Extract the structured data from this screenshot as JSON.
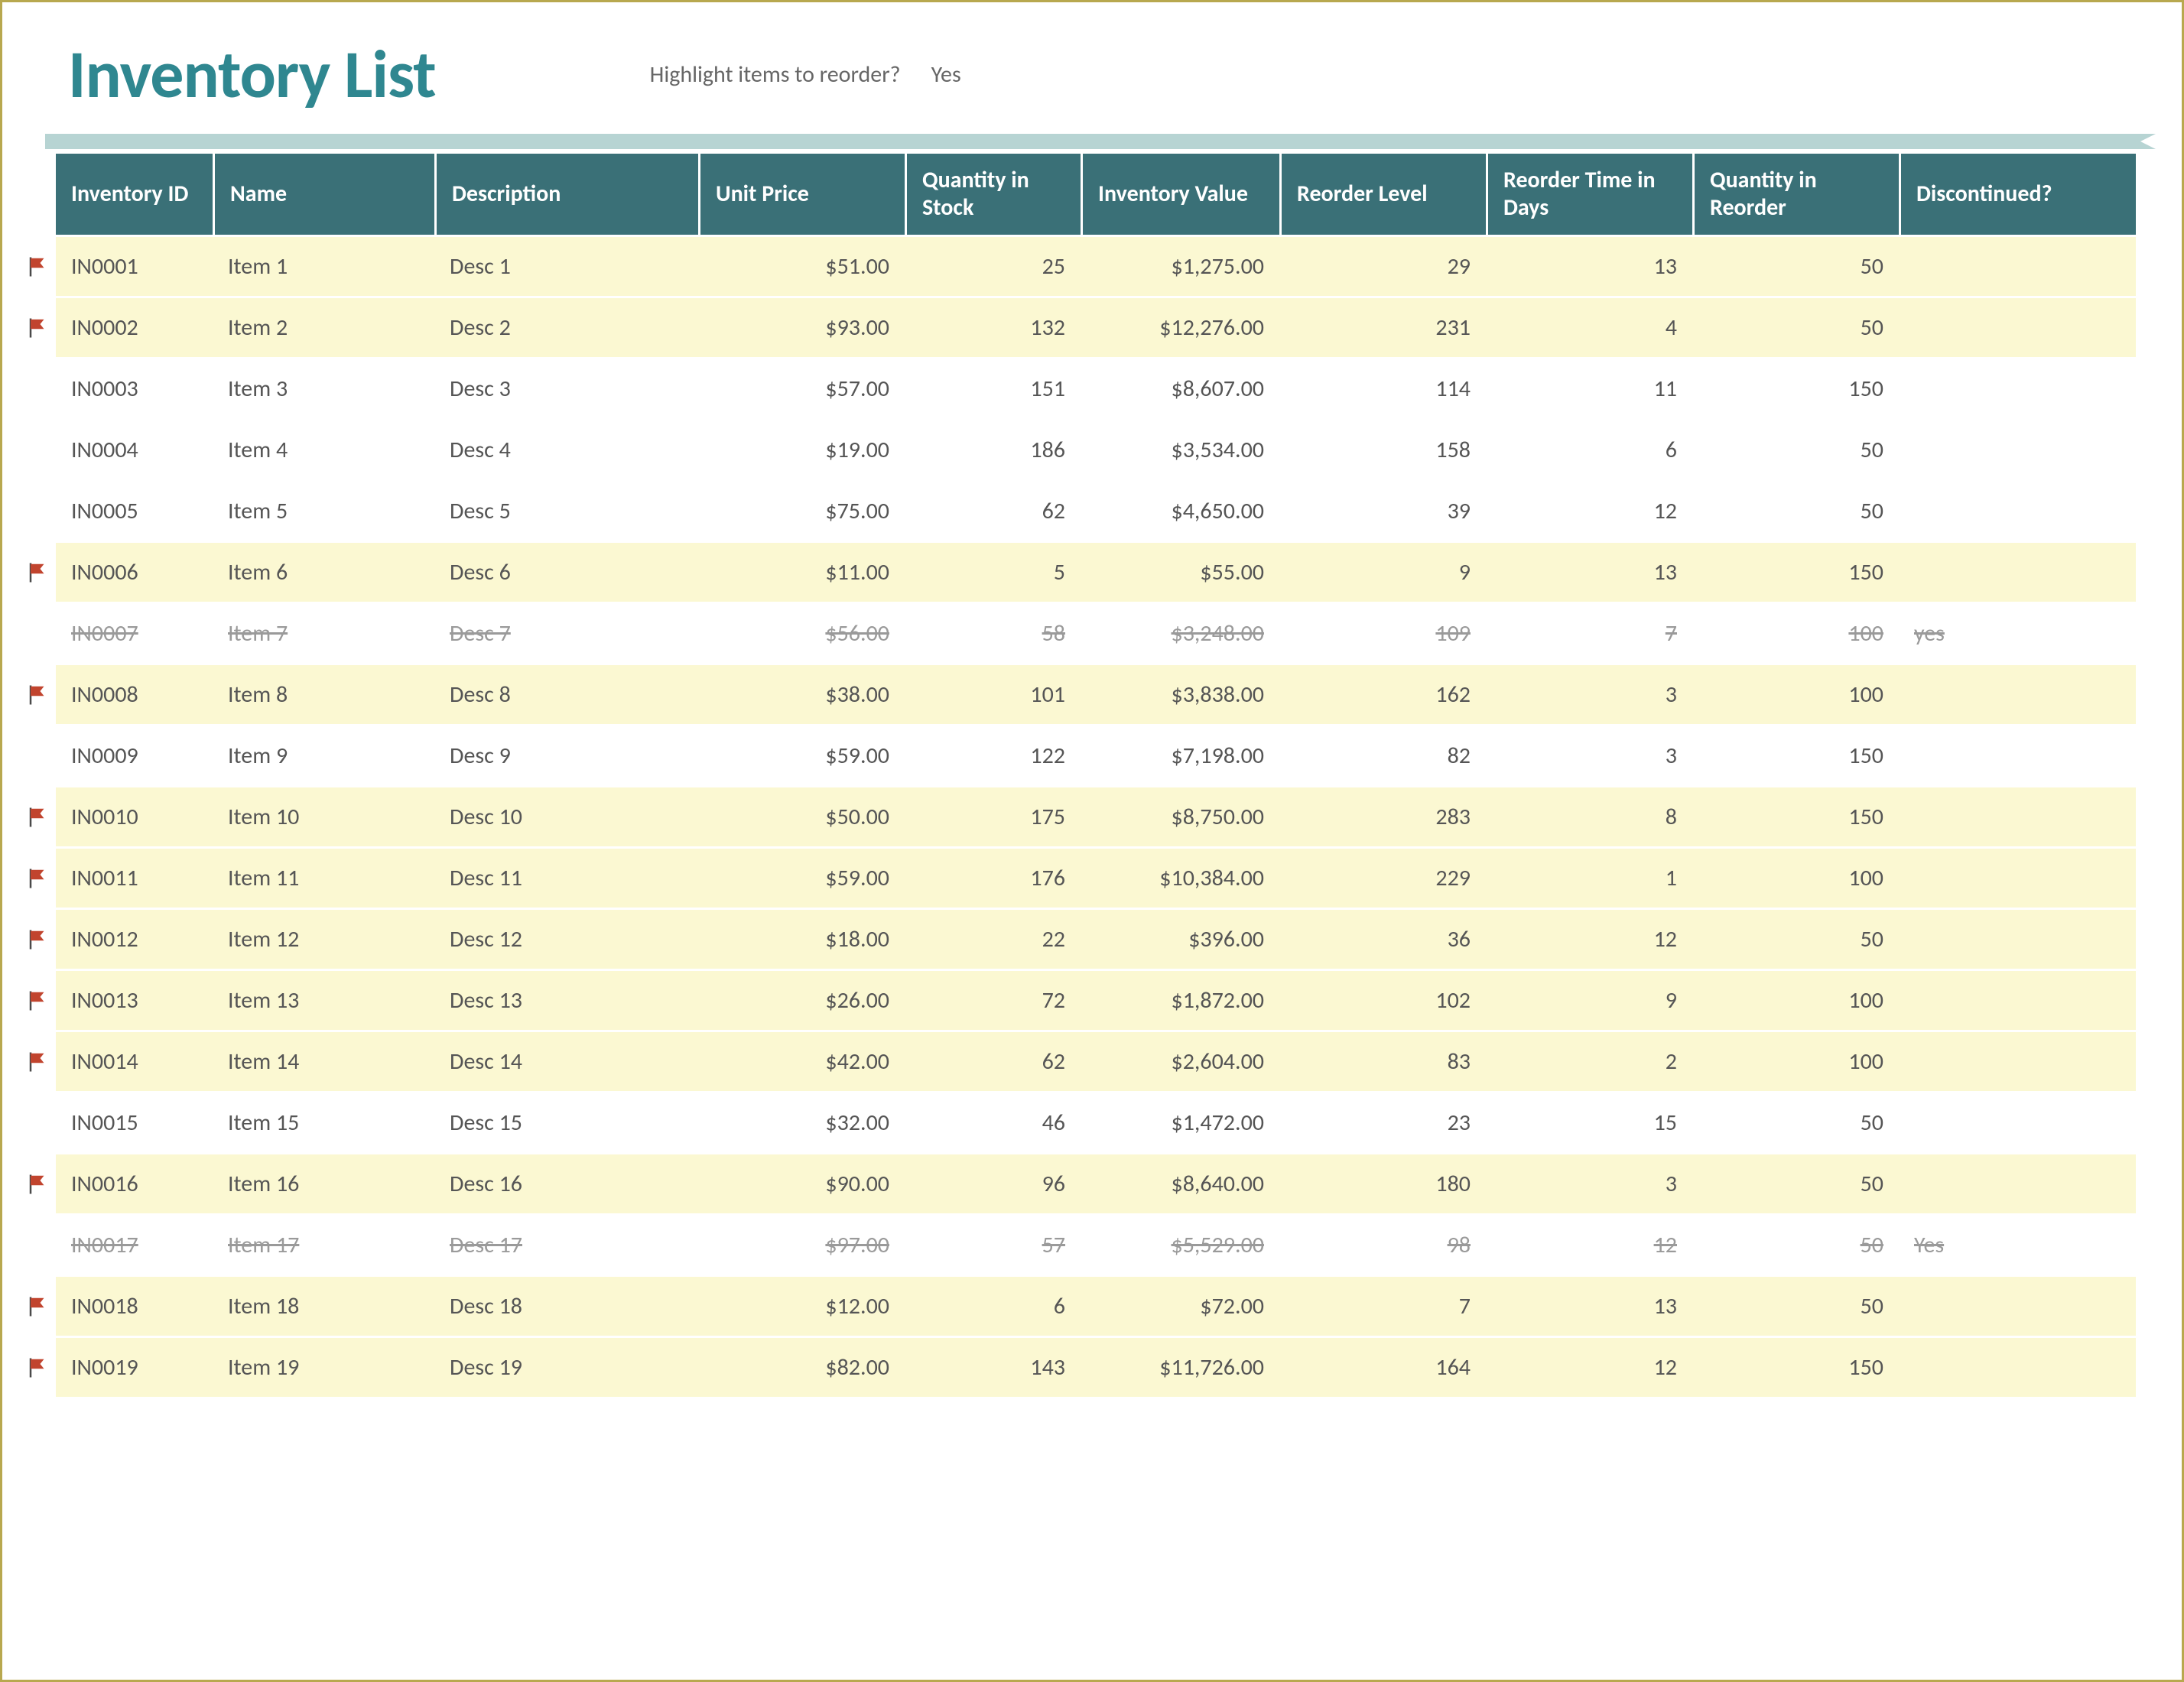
{
  "title": "Inventory List",
  "highlight_label": "Highlight items to reorder?",
  "highlight_value": "Yes",
  "headers": {
    "id": "Inventory ID",
    "name": "Name",
    "desc": "Description",
    "price": "Unit Price",
    "qty": "Quantity in Stock",
    "value": "Inventory Value",
    "reorder": "Reorder Level",
    "days": "Reorder Time in Days",
    "qreorder": "Quantity in Reorder",
    "disc": "Discontinued?"
  },
  "rows": [
    {
      "flag": true,
      "hl": true,
      "disc": "",
      "id": "IN0001",
      "name": "Item 1",
      "desc": "Desc 1",
      "price": "$51.00",
      "qty": "25",
      "value": "$1,275.00",
      "reorder": "29",
      "days": "13",
      "qreorder": "50"
    },
    {
      "flag": true,
      "hl": true,
      "disc": "",
      "id": "IN0002",
      "name": "Item 2",
      "desc": "Desc 2",
      "price": "$93.00",
      "qty": "132",
      "value": "$12,276.00",
      "reorder": "231",
      "days": "4",
      "qreorder": "50"
    },
    {
      "flag": false,
      "hl": false,
      "disc": "",
      "id": "IN0003",
      "name": "Item 3",
      "desc": "Desc 3",
      "price": "$57.00",
      "qty": "151",
      "value": "$8,607.00",
      "reorder": "114",
      "days": "11",
      "qreorder": "150"
    },
    {
      "flag": false,
      "hl": false,
      "disc": "",
      "id": "IN0004",
      "name": "Item 4",
      "desc": "Desc 4",
      "price": "$19.00",
      "qty": "186",
      "value": "$3,534.00",
      "reorder": "158",
      "days": "6",
      "qreorder": "50"
    },
    {
      "flag": false,
      "hl": false,
      "disc": "",
      "id": "IN0005",
      "name": "Item 5",
      "desc": "Desc 5",
      "price": "$75.00",
      "qty": "62",
      "value": "$4,650.00",
      "reorder": "39",
      "days": "12",
      "qreorder": "50"
    },
    {
      "flag": true,
      "hl": true,
      "disc": "",
      "id": "IN0006",
      "name": "Item 6",
      "desc": "Desc 6",
      "price": "$11.00",
      "qty": "5",
      "value": "$55.00",
      "reorder": "9",
      "days": "13",
      "qreorder": "150"
    },
    {
      "flag": false,
      "hl": false,
      "disc": "yes",
      "id": "IN0007",
      "name": "Item 7",
      "desc": "Desc 7",
      "price": "$56.00",
      "qty": "58",
      "value": "$3,248.00",
      "reorder": "109",
      "days": "7",
      "qreorder": "100"
    },
    {
      "flag": true,
      "hl": true,
      "disc": "",
      "id": "IN0008",
      "name": "Item 8",
      "desc": "Desc 8",
      "price": "$38.00",
      "qty": "101",
      "value": "$3,838.00",
      "reorder": "162",
      "days": "3",
      "qreorder": "100"
    },
    {
      "flag": false,
      "hl": false,
      "disc": "",
      "id": "IN0009",
      "name": "Item 9",
      "desc": "Desc 9",
      "price": "$59.00",
      "qty": "122",
      "value": "$7,198.00",
      "reorder": "82",
      "days": "3",
      "qreorder": "150"
    },
    {
      "flag": true,
      "hl": true,
      "disc": "",
      "id": "IN0010",
      "name": "Item 10",
      "desc": "Desc 10",
      "price": "$50.00",
      "qty": "175",
      "value": "$8,750.00",
      "reorder": "283",
      "days": "8",
      "qreorder": "150"
    },
    {
      "flag": true,
      "hl": true,
      "disc": "",
      "id": "IN0011",
      "name": "Item 11",
      "desc": "Desc 11",
      "price": "$59.00",
      "qty": "176",
      "value": "$10,384.00",
      "reorder": "229",
      "days": "1",
      "qreorder": "100"
    },
    {
      "flag": true,
      "hl": true,
      "disc": "",
      "id": "IN0012",
      "name": "Item 12",
      "desc": "Desc 12",
      "price": "$18.00",
      "qty": "22",
      "value": "$396.00",
      "reorder": "36",
      "days": "12",
      "qreorder": "50"
    },
    {
      "flag": true,
      "hl": true,
      "disc": "",
      "id": "IN0013",
      "name": "Item 13",
      "desc": "Desc 13",
      "price": "$26.00",
      "qty": "72",
      "value": "$1,872.00",
      "reorder": "102",
      "days": "9",
      "qreorder": "100"
    },
    {
      "flag": true,
      "hl": true,
      "disc": "",
      "id": "IN0014",
      "name": "Item 14",
      "desc": "Desc 14",
      "price": "$42.00",
      "qty": "62",
      "value": "$2,604.00",
      "reorder": "83",
      "days": "2",
      "qreorder": "100"
    },
    {
      "flag": false,
      "hl": false,
      "disc": "",
      "id": "IN0015",
      "name": "Item 15",
      "desc": "Desc 15",
      "price": "$32.00",
      "qty": "46",
      "value": "$1,472.00",
      "reorder": "23",
      "days": "15",
      "qreorder": "50"
    },
    {
      "flag": true,
      "hl": true,
      "disc": "",
      "id": "IN0016",
      "name": "Item 16",
      "desc": "Desc 16",
      "price": "$90.00",
      "qty": "96",
      "value": "$8,640.00",
      "reorder": "180",
      "days": "3",
      "qreorder": "50"
    },
    {
      "flag": false,
      "hl": false,
      "disc": "Yes",
      "id": "IN0017",
      "name": "Item 17",
      "desc": "Desc 17",
      "price": "$97.00",
      "qty": "57",
      "value": "$5,529.00",
      "reorder": "98",
      "days": "12",
      "qreorder": "50"
    },
    {
      "flag": true,
      "hl": true,
      "disc": "",
      "id": "IN0018",
      "name": "Item 18",
      "desc": "Desc 18",
      "price": "$12.00",
      "qty": "6",
      "value": "$72.00",
      "reorder": "7",
      "days": "13",
      "qreorder": "50"
    },
    {
      "flag": true,
      "hl": true,
      "disc": "",
      "id": "IN0019",
      "name": "Item 19",
      "desc": "Desc 19",
      "price": "$82.00",
      "qty": "143",
      "value": "$11,726.00",
      "reorder": "164",
      "days": "12",
      "qreorder": "150"
    }
  ]
}
